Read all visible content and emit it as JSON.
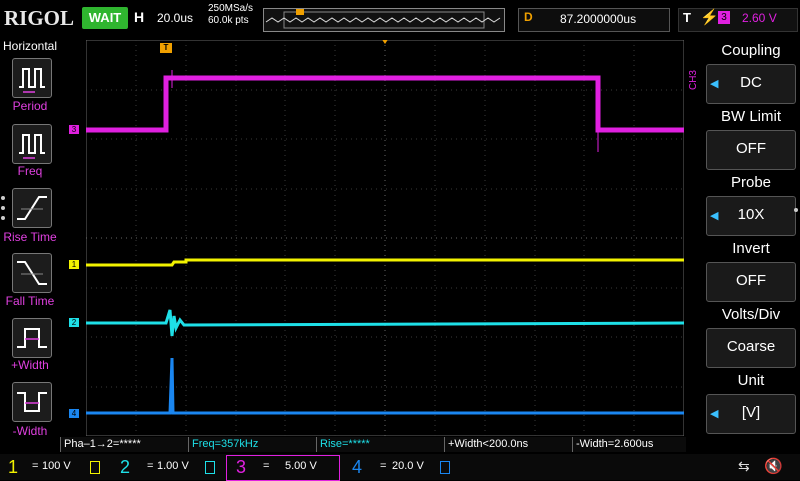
{
  "brand": "RIGOL",
  "run_state": "WAIT",
  "horizontal": {
    "label": "H",
    "timebase": "20.0us",
    "sample_rate": "250MSa/s",
    "memory_depth": "60.0k pts",
    "delay_label": "D",
    "delay_value": "87.2000000us"
  },
  "trigger": {
    "label": "T",
    "source": "3",
    "level": "2.60 V",
    "marker": "T"
  },
  "left_menu": {
    "title": "Horizontal",
    "items": [
      {
        "label": "Period",
        "icon": "period-icon"
      },
      {
        "label": "Freq",
        "icon": "freq-icon"
      },
      {
        "label": "Rise Time",
        "icon": "rise-time-icon"
      },
      {
        "label": "Fall Time",
        "icon": "fall-time-icon"
      },
      {
        "label": "+Width",
        "icon": "positive-width-icon"
      },
      {
        "label": "-Width",
        "icon": "negative-width-icon"
      }
    ]
  },
  "right_menu": {
    "channel_tag": "CH3",
    "items": [
      {
        "title": "Coupling",
        "value": "DC"
      },
      {
        "title": "BW Limit",
        "value": "OFF"
      },
      {
        "title": "Probe",
        "value": "10X"
      },
      {
        "title": "Invert",
        "value": "OFF"
      },
      {
        "title": "Volts/Div",
        "value": "Coarse"
      },
      {
        "title": "Unit",
        "value": "[V]"
      }
    ]
  },
  "measurements": [
    "Pha–1→2=*****",
    "Freq=357kHz",
    "Rise=*****",
    "+Width<200.0ns",
    "-Width=2.600us"
  ],
  "channels": [
    {
      "num": "1",
      "scale": "100 V",
      "color": "#f2f200",
      "coupling_symbol": "="
    },
    {
      "num": "2",
      "scale": "1.00 V",
      "color": "#1ee0e8",
      "coupling_symbol": "="
    },
    {
      "num": "3",
      "scale": "5.00 V",
      "color": "#e020e0",
      "coupling_symbol": "="
    },
    {
      "num": "4",
      "scale": "20.0 V",
      "color": "#1a86f0",
      "coupling_symbol": "="
    }
  ],
  "trace_markers": {
    "ch1": "1",
    "ch2": "2",
    "ch3": "3",
    "ch4": "4"
  },
  "colors": {
    "ch1": "#f2f200",
    "ch2": "#1ee0e8",
    "ch3": "#e020e0",
    "ch4": "#1a86f0",
    "run": "#2fb52f",
    "accent": "#f0a000"
  }
}
